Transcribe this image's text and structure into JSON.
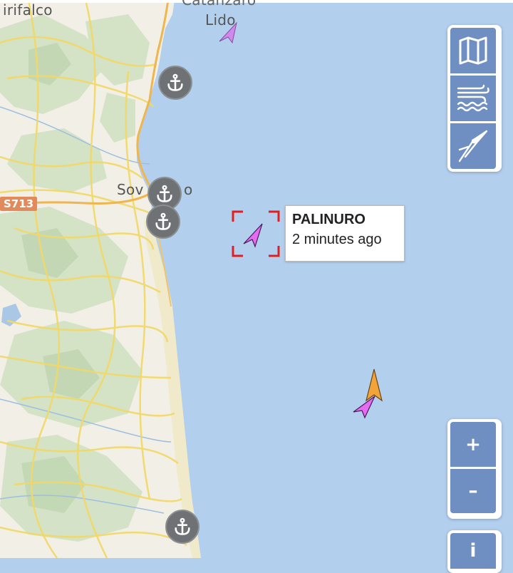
{
  "map": {
    "places": {
      "girifalco": "irifalco",
      "catanzaro_lido_top": "Catanzaro",
      "catanzaro_lido": "Lido",
      "soverato_left": "Sov",
      "soverato_right": "o"
    },
    "road_shield": "S713",
    "colors": {
      "sea": "#b3cfee",
      "land": "#f2efe6",
      "vessel_selected": "#e36cf0",
      "vessel_other": "#f2a43a",
      "selection": "#e02020",
      "control": "#6f8fc2"
    }
  },
  "popup": {
    "vessel_name": "PALINURO",
    "last_seen": "2 minutes ago"
  },
  "controls": {
    "layers": [
      "map-icon",
      "wind-waves-icon",
      "compass-icon"
    ],
    "zoom_in": "+",
    "zoom_out": "–",
    "info": "i"
  }
}
